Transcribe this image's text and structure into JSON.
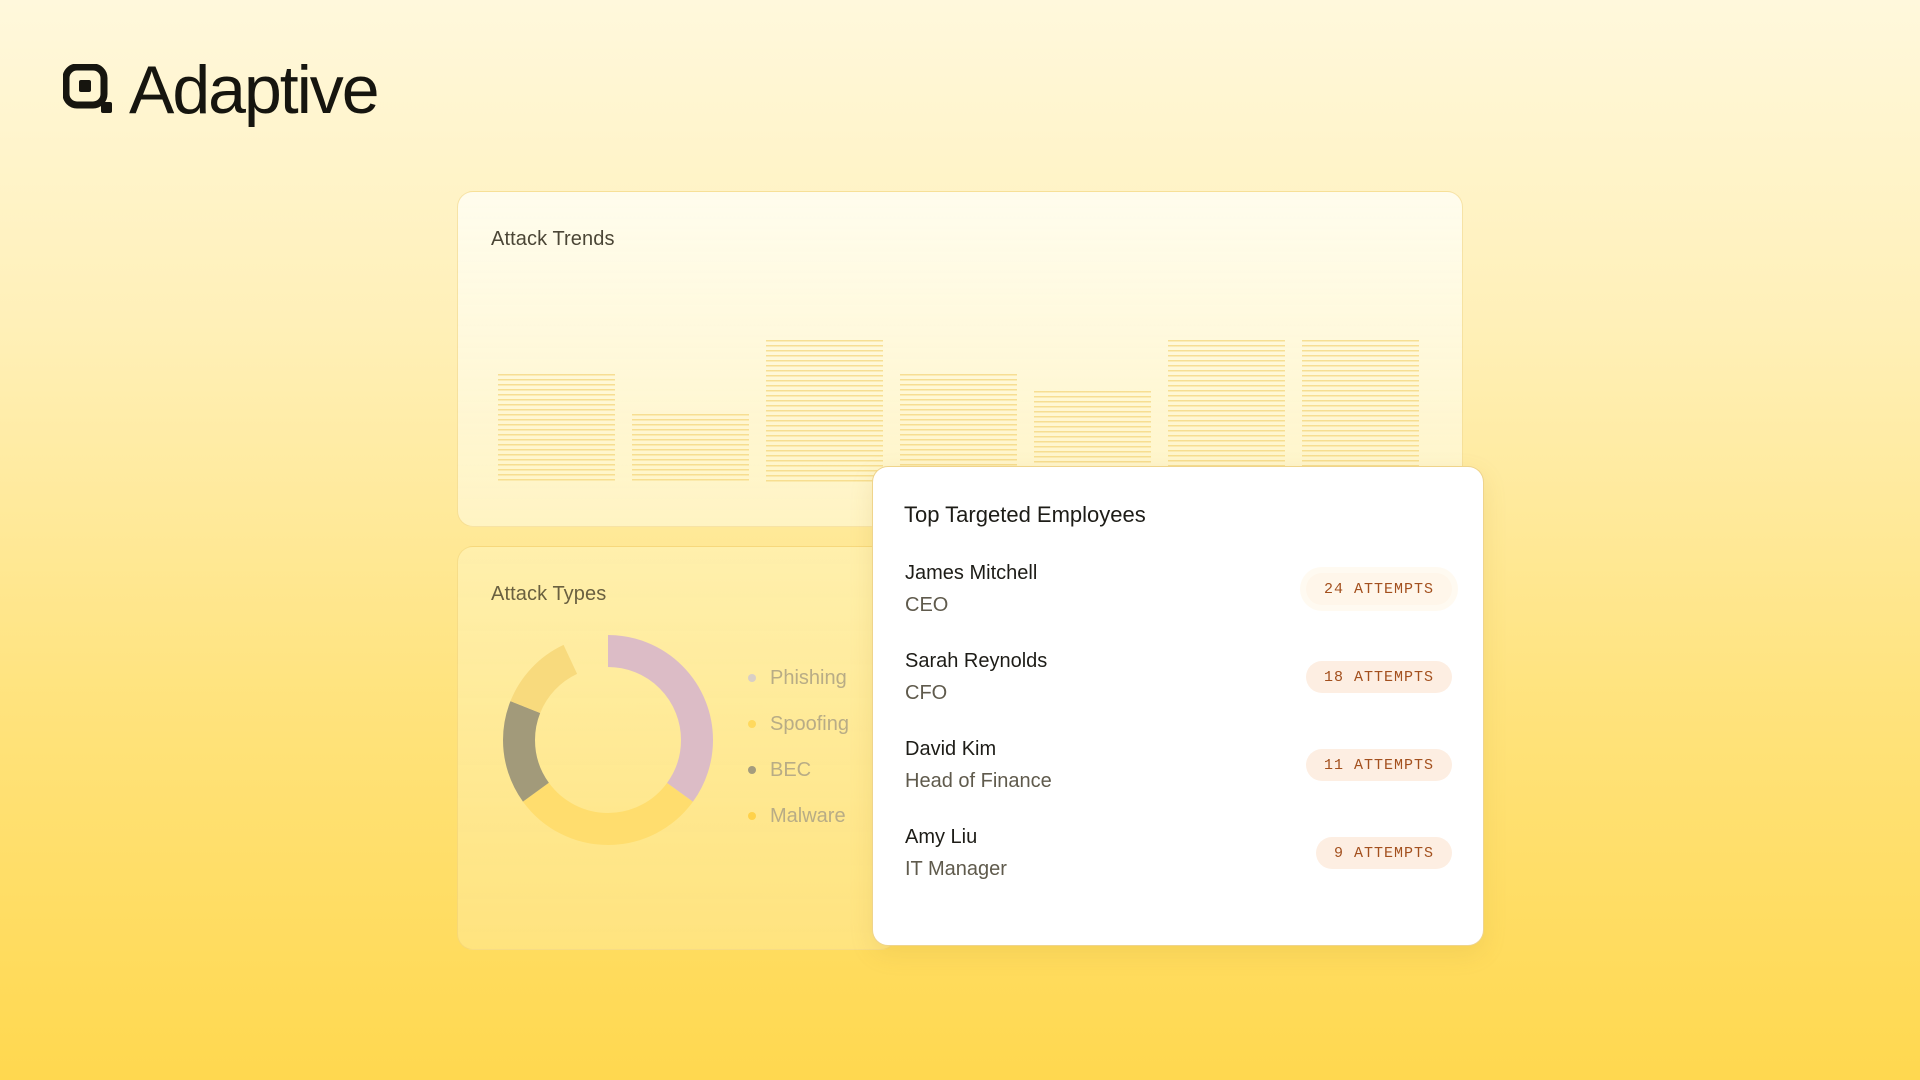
{
  "brand": {
    "name": "Adaptive"
  },
  "attack_trends": {
    "title": "Attack Trends",
    "bar_levels": [
      0.58,
      0.37,
      0.76,
      0.58,
      0.49,
      0.76,
      0.76
    ]
  },
  "attack_types": {
    "title": "Attack Types",
    "legend": [
      {
        "label": "Phishing",
        "color": "#d9b8c4"
      },
      {
        "label": "Spoofing",
        "color": "#ffda6a"
      },
      {
        "label": "BEC",
        "color": "#9c9679"
      },
      {
        "label": "Malware",
        "color": "#f7d679"
      }
    ],
    "slices": [
      {
        "label": "Phishing",
        "fraction": 0.42,
        "color": "#dcbcc6"
      },
      {
        "label": "Spoofing",
        "fraction": 0.3,
        "color": "#ffdd6e"
      },
      {
        "label": "BEC",
        "fraction": 0.16,
        "color": "#a29a7a"
      },
      {
        "label": "Malware",
        "fraction": 0.12,
        "color": "#f8da7d"
      }
    ]
  },
  "top_targeted": {
    "title": "Top Targeted Employees",
    "employees": [
      {
        "name": "James Mitchell",
        "role": "CEO",
        "attempts": "24 ATTEMPTS"
      },
      {
        "name": "Sarah Reynolds",
        "role": "CFO",
        "attempts": "18 ATTEMPTS"
      },
      {
        "name": "David Kim",
        "role": "Head of Finance",
        "attempts": "11 ATTEMPTS"
      },
      {
        "name": "Amy Liu",
        "role": "IT Manager",
        "attempts": "9 ATTEMPTS"
      }
    ]
  }
}
